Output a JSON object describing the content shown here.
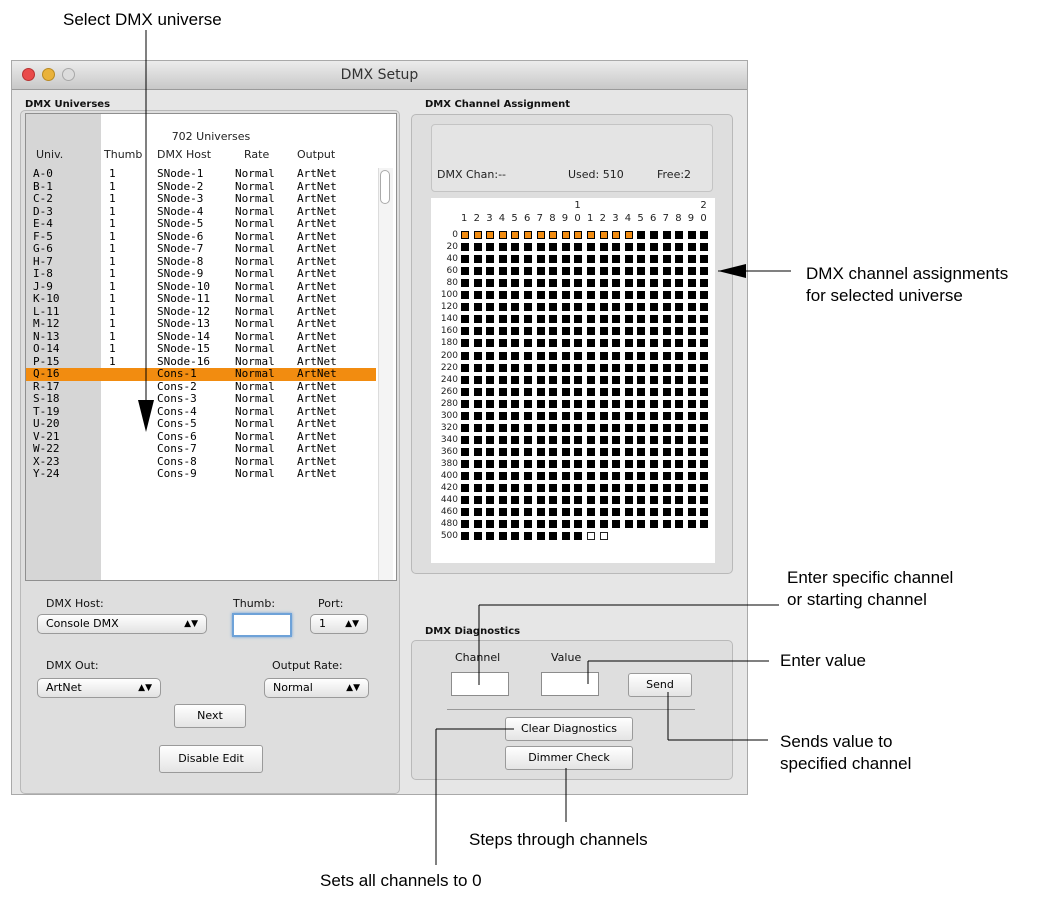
{
  "annotations": {
    "select_universe": "Select DMX universe",
    "channel_assignments_line1": "DMX channel assignments",
    "channel_assignments_line2": "for selected universe",
    "enter_channel_line1": "Enter specific channel",
    "enter_channel_line2": "or starting channel",
    "enter_value": "Enter value",
    "sends_value_line1": "Sends value to",
    "sends_value_line2": "specified channel",
    "steps_through": "Steps through channels",
    "sets_all_zero": "Sets all channels to 0"
  },
  "window": {
    "title": "DMX Setup"
  },
  "universes": {
    "section_label": "DMX Universes",
    "count_text": "702 Universes",
    "headers": {
      "univ": "Univ.",
      "thumb": "Thumb",
      "host": "DMX Host",
      "rate": "Rate",
      "output": "Output"
    },
    "selected_index": 16,
    "rows": [
      {
        "univ": "A-0",
        "thumb": "1",
        "host": "SNode-1",
        "rate": "Normal",
        "output": "ArtNet"
      },
      {
        "univ": "B-1",
        "thumb": "1",
        "host": "SNode-2",
        "rate": "Normal",
        "output": "ArtNet"
      },
      {
        "univ": "C-2",
        "thumb": "1",
        "host": "SNode-3",
        "rate": "Normal",
        "output": "ArtNet"
      },
      {
        "univ": "D-3",
        "thumb": "1",
        "host": "SNode-4",
        "rate": "Normal",
        "output": "ArtNet"
      },
      {
        "univ": "E-4",
        "thumb": "1",
        "host": "SNode-5",
        "rate": "Normal",
        "output": "ArtNet"
      },
      {
        "univ": "F-5",
        "thumb": "1",
        "host": "SNode-6",
        "rate": "Normal",
        "output": "ArtNet"
      },
      {
        "univ": "G-6",
        "thumb": "1",
        "host": "SNode-7",
        "rate": "Normal",
        "output": "ArtNet"
      },
      {
        "univ": "H-7",
        "thumb": "1",
        "host": "SNode-8",
        "rate": "Normal",
        "output": "ArtNet"
      },
      {
        "univ": "I-8",
        "thumb": "1",
        "host": "SNode-9",
        "rate": "Normal",
        "output": "ArtNet"
      },
      {
        "univ": "J-9",
        "thumb": "1",
        "host": "SNode-10",
        "rate": "Normal",
        "output": "ArtNet"
      },
      {
        "univ": "K-10",
        "thumb": "1",
        "host": "SNode-11",
        "rate": "Normal",
        "output": "ArtNet"
      },
      {
        "univ": "L-11",
        "thumb": "1",
        "host": "SNode-12",
        "rate": "Normal",
        "output": "ArtNet"
      },
      {
        "univ": "M-12",
        "thumb": "1",
        "host": "SNode-13",
        "rate": "Normal",
        "output": "ArtNet"
      },
      {
        "univ": "N-13",
        "thumb": "1",
        "host": "SNode-14",
        "rate": "Normal",
        "output": "ArtNet"
      },
      {
        "univ": "O-14",
        "thumb": "1",
        "host": "SNode-15",
        "rate": "Normal",
        "output": "ArtNet"
      },
      {
        "univ": "P-15",
        "thumb": "1",
        "host": "SNode-16",
        "rate": "Normal",
        "output": "ArtNet"
      },
      {
        "univ": "Q-16",
        "thumb": "",
        "host": "Cons-1",
        "rate": "Normal",
        "output": "ArtNet"
      },
      {
        "univ": "R-17",
        "thumb": "",
        "host": "Cons-2",
        "rate": "Normal",
        "output": "ArtNet"
      },
      {
        "univ": "S-18",
        "thumb": "",
        "host": "Cons-3",
        "rate": "Normal",
        "output": "ArtNet"
      },
      {
        "univ": "T-19",
        "thumb": "",
        "host": "Cons-4",
        "rate": "Normal",
        "output": "ArtNet"
      },
      {
        "univ": "U-20",
        "thumb": "",
        "host": "Cons-5",
        "rate": "Normal",
        "output": "ArtNet"
      },
      {
        "univ": "V-21",
        "thumb": "",
        "host": "Cons-6",
        "rate": "Normal",
        "output": "ArtNet"
      },
      {
        "univ": "W-22",
        "thumb": "",
        "host": "Cons-7",
        "rate": "Normal",
        "output": "ArtNet"
      },
      {
        "univ": "X-23",
        "thumb": "",
        "host": "Cons-8",
        "rate": "Normal",
        "output": "ArtNet"
      },
      {
        "univ": "Y-24",
        "thumb": "",
        "host": "Cons-9",
        "rate": "Normal",
        "output": "ArtNet"
      }
    ]
  },
  "controls": {
    "dmx_host_label": "DMX Host:",
    "dmx_host_value": "Console DMX",
    "thumb_label": "Thumb:",
    "thumb_value": "",
    "port_label": "Port:",
    "port_value": "1",
    "dmx_out_label": "DMX Out:",
    "dmx_out_value": "ArtNet",
    "output_rate_label": "Output Rate:",
    "output_rate_value": "Normal",
    "next_button": "Next",
    "disable_edit_button": "Disable Edit"
  },
  "assignment": {
    "section_label": "DMX Channel Assignment",
    "dmx_chan": "DMX Chan:--",
    "used": "Used: 510",
    "free": "Free:2",
    "col_tens": [
      "1",
      "2"
    ],
    "col_units": [
      "1",
      "2",
      "3",
      "4",
      "5",
      "6",
      "7",
      "8",
      "9",
      "0",
      "1",
      "2",
      "3",
      "4",
      "5",
      "6",
      "7",
      "8",
      "9",
      "0"
    ],
    "row_labels": [
      "0",
      "20",
      "40",
      "60",
      "80",
      "100",
      "120",
      "140",
      "160",
      "180",
      "200",
      "220",
      "240",
      "260",
      "280",
      "300",
      "320",
      "340",
      "360",
      "380",
      "400",
      "420",
      "440",
      "460",
      "480",
      "500"
    ],
    "highlighted_cells_row0": 14,
    "total_channels": 512,
    "used_channels": 510
  },
  "diagnostics": {
    "section_label": "DMX Diagnostics",
    "channel_label": "Channel",
    "value_label": "Value",
    "channel_value": "",
    "value_value": "",
    "send_button": "Send",
    "clear_button": "Clear Diagnostics",
    "dimmer_button": "Dimmer Check"
  }
}
